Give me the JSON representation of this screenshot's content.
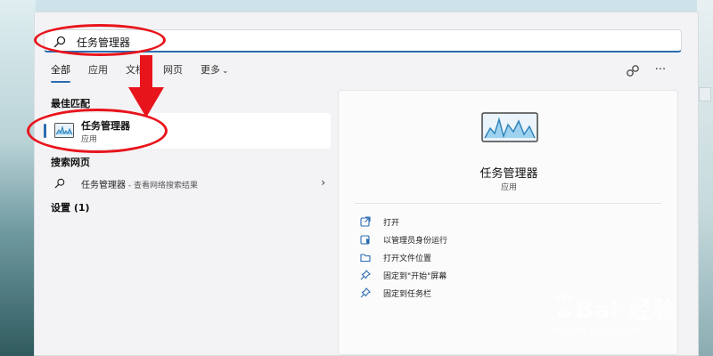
{
  "search": {
    "query": "任务管理器",
    "icon": "search-icon"
  },
  "tabs": [
    {
      "label": "全部",
      "active": true
    },
    {
      "label": "应用",
      "active": false
    },
    {
      "label": "文档",
      "active": false
    },
    {
      "label": "网页",
      "active": false
    },
    {
      "label": "更多",
      "active": false
    }
  ],
  "toolbar": {
    "share_icon": "connect-icon",
    "more_icon": "more-options-icon",
    "more_glyph": "···"
  },
  "best_match": {
    "section_title": "最佳匹配",
    "name": "任务管理器",
    "type": "应用"
  },
  "web_search": {
    "section_title": "搜索网页",
    "name": "任务管理器",
    "hint": " - 查看网络搜索结果",
    "chevron": "›"
  },
  "settings": {
    "section_title": "设置 (1)"
  },
  "detail": {
    "name": "任务管理器",
    "type": "应用",
    "actions": [
      {
        "label": "打开",
        "icon": "open-external-icon"
      },
      {
        "label": "以管理员身份运行",
        "icon": "admin-shield-icon"
      },
      {
        "label": "打开文件位置",
        "icon": "folder-icon"
      },
      {
        "label": "固定到\"开始\"屏幕",
        "icon": "pin-icon"
      },
      {
        "label": "固定到任务栏",
        "icon": "pin-icon"
      }
    ]
  },
  "colors": {
    "annotation": "#e8141c",
    "accent": "#2b6cb0"
  },
  "watermark": {
    "brand": "Bai  经验",
    "url": "jingyan.baidu.com"
  }
}
